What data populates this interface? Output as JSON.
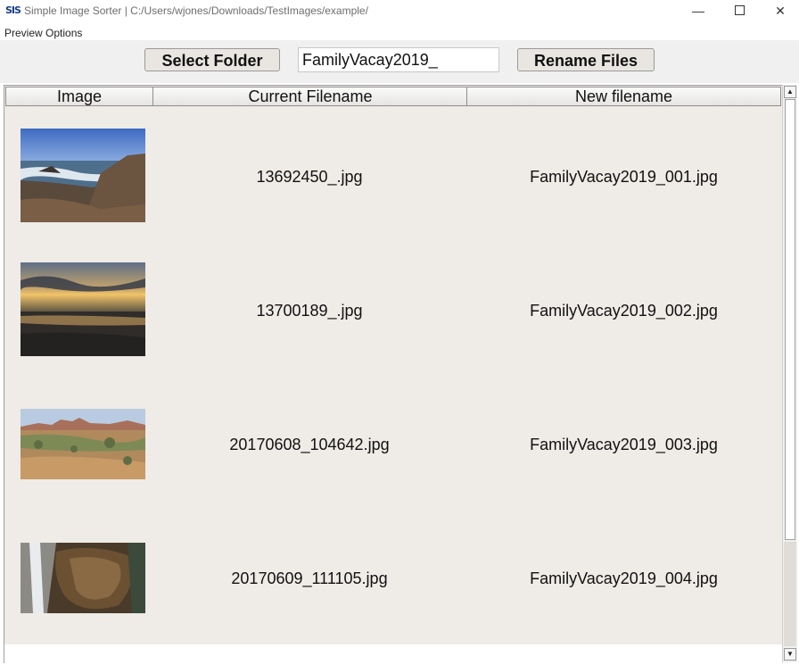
{
  "window": {
    "app_icon_text": "SIS",
    "title": "Simple Image Sorter | C:/Users/wjones/Downloads/TestImages/example/",
    "minimize_glyph": "—",
    "close_glyph": "✕"
  },
  "menu": {
    "items": [
      "Preview Options"
    ]
  },
  "toolbar": {
    "select_folder_label": "Select Folder",
    "prefix_value": "FamilyVacay2019_",
    "rename_label": "Rename Files"
  },
  "table": {
    "columns": [
      "Image",
      "Current Filename",
      "New filename"
    ],
    "rows": [
      {
        "thumbnail": "rocky-coast-thumbnail",
        "current": "13692450_.jpg",
        "new": "FamilyVacay2019_001.jpg"
      },
      {
        "thumbnail": "beach-sunset-thumbnail",
        "current": "13700189_.jpg",
        "new": "FamilyVacay2019_002.jpg"
      },
      {
        "thumbnail": "desert-landscape-thumbnail",
        "current": "20170608_104642.jpg",
        "new": "FamilyVacay2019_003.jpg"
      },
      {
        "thumbnail": "waterfall-rock-thumbnail",
        "current": "20170609_111105.jpg",
        "new": "FamilyVacay2019_004.jpg"
      }
    ]
  },
  "scrollbar": {
    "up_glyph": "▲",
    "down_glyph": "▼"
  }
}
